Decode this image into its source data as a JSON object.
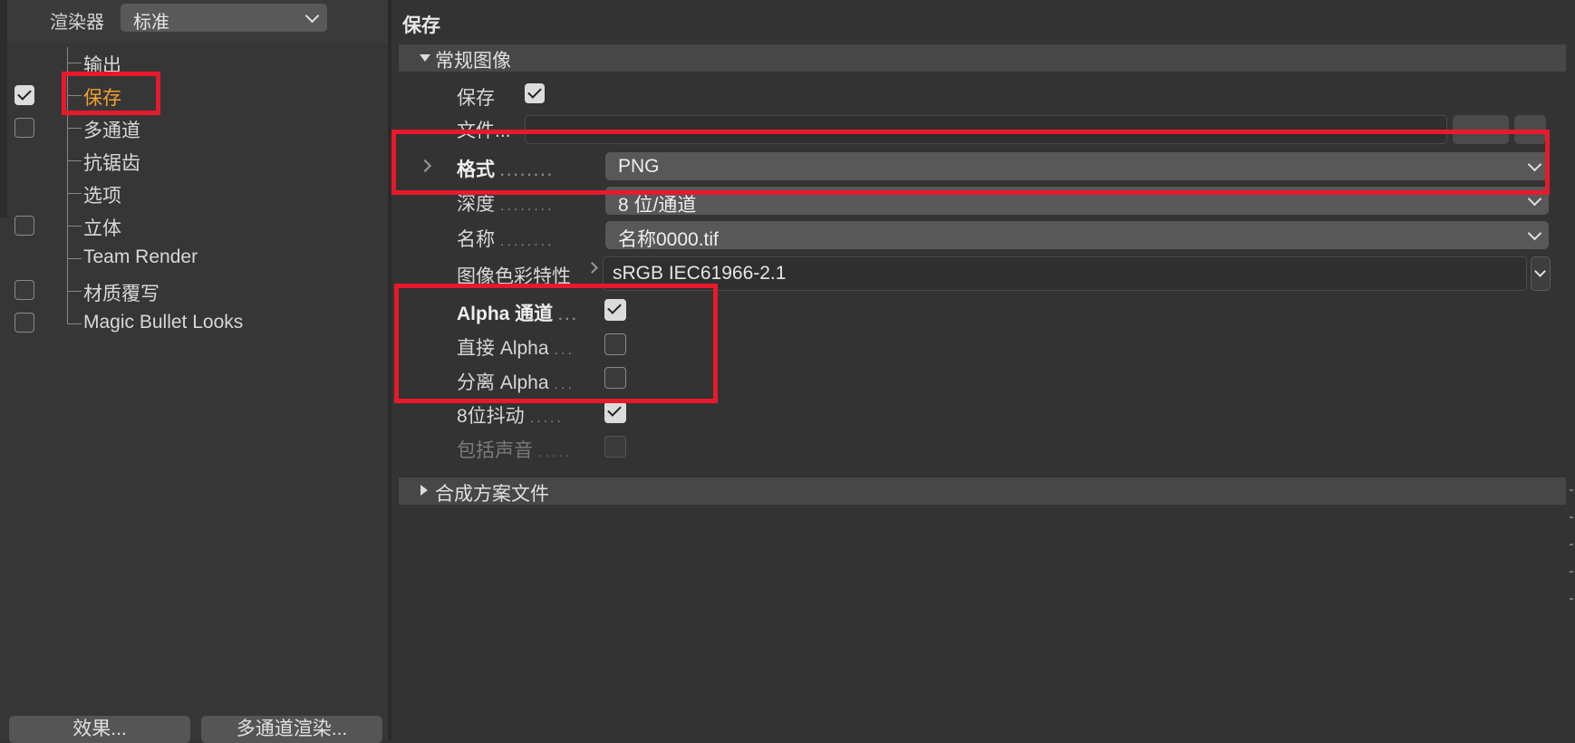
{
  "renderer": {
    "label": "渲染器",
    "value": "标准"
  },
  "tree": [
    {
      "label": "输出",
      "checkbox": null,
      "active": false
    },
    {
      "label": "保存",
      "checkbox": true,
      "active": true
    },
    {
      "label": "多通道",
      "checkbox": false,
      "active": false
    },
    {
      "label": "抗锯齿",
      "checkbox": null,
      "active": false
    },
    {
      "label": "选项",
      "checkbox": null,
      "active": false
    },
    {
      "label": "立体",
      "checkbox": false,
      "active": false
    },
    {
      "label": "Team Render",
      "checkbox": null,
      "active": false
    },
    {
      "label": "材质覆写",
      "checkbox": false,
      "active": false
    },
    {
      "label": "Magic Bullet Looks",
      "checkbox": false,
      "active": false
    }
  ],
  "bottom_buttons": {
    "effects": "效果...",
    "multipass_render": "多通道渲染..."
  },
  "page_title": "保存",
  "sections": {
    "regular_image": "常规图像",
    "compositing_project_file": "合成方案文件"
  },
  "props": {
    "save": {
      "label": "保存",
      "checked": true
    },
    "file": {
      "label": "文件...",
      "value": ""
    },
    "format": {
      "label": "格式",
      "value": "PNG"
    },
    "depth": {
      "label": "深度",
      "value": "8 位/通道"
    },
    "name": {
      "label": "名称",
      "value": "名称0000.tif"
    },
    "color_profile": {
      "label": "图像色彩特性",
      "value": "sRGB IEC61966-2.1"
    },
    "alpha_channel": {
      "label": "Alpha 通道",
      "checked": true
    },
    "straight_alpha": {
      "label": "直接 Alpha",
      "checked": false
    },
    "separate_alpha": {
      "label": "分离 Alpha",
      "checked": false
    },
    "dither_8bit": {
      "label": "8位抖动",
      "checked": true
    },
    "include_sound": {
      "label": "包括声音",
      "checked": false,
      "disabled": true
    }
  },
  "dots": {
    "long": "........",
    "short": "...",
    "medium": "....."
  },
  "colors": {
    "active_item": "#f0a030",
    "highlight_box": "#e8192c",
    "panel_bg": "#333333"
  }
}
